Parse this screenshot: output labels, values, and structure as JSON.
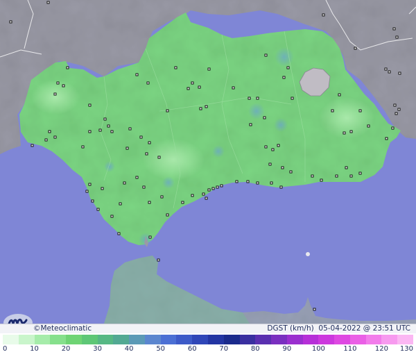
{
  "brand": {
    "copyright": "©",
    "name": "Meteoclimatic"
  },
  "map_info": {
    "variable": "DGST (km/h)",
    "timestamp": "05-04-2022 @ 23:51 UTC"
  },
  "scale": {
    "ticks": [
      "0",
      "10",
      "20",
      "30",
      "40",
      "50",
      "60",
      "70",
      "80",
      "90",
      "100",
      "110",
      "120",
      "130"
    ],
    "colors": [
      "#e8fbe9",
      "#c9f5cb",
      "#a6ecaa",
      "#86e08c",
      "#6fd474",
      "#5ec776",
      "#56b884",
      "#52a993",
      "#5b9ab6",
      "#5b86cf",
      "#4b6fd4",
      "#3d5ac8",
      "#2f46b8",
      "#2335a3",
      "#1a2a8c",
      "#3a2fa0",
      "#5a2fb0",
      "#7a2fc0",
      "#9a2fcf",
      "#b62fd8",
      "#cc38de",
      "#de48e2",
      "#ea5fe6",
      "#f27ceb",
      "#f79aef",
      "#fbb7f3"
    ]
  },
  "colors": {
    "sea": "#7f86d6",
    "land_andalusia": "#7cd683",
    "land_other": "#9a9aa6",
    "mountain": "#c0bcc4"
  }
}
